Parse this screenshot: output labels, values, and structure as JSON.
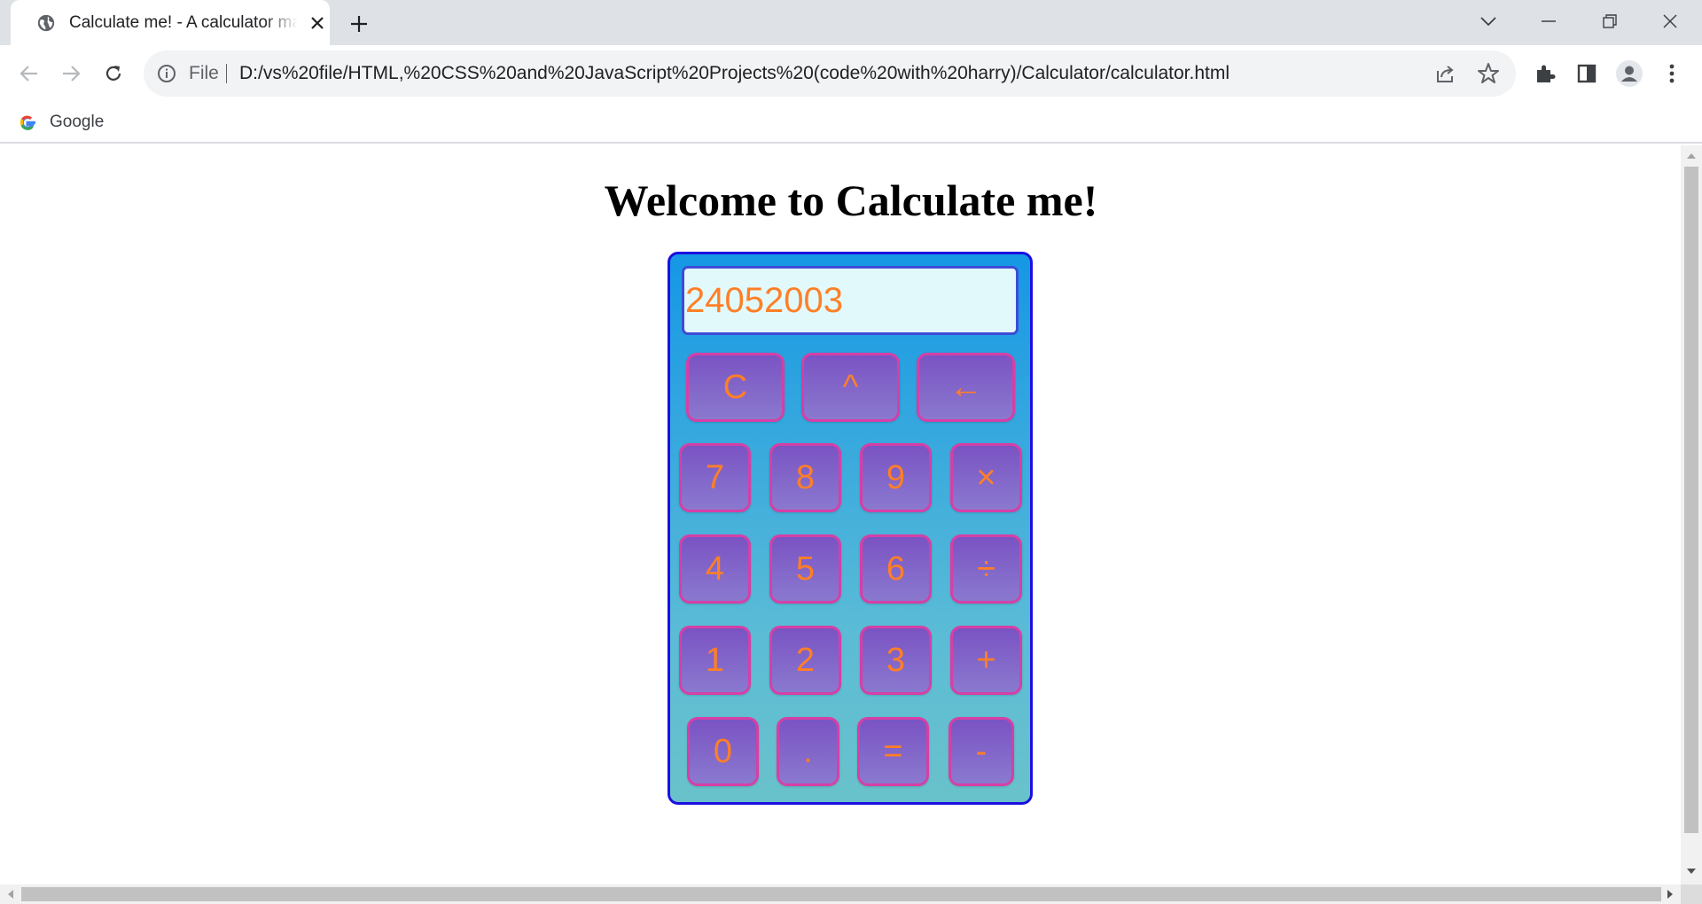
{
  "browser": {
    "tab_title": "Calculate me! - A calculator made by Harry",
    "address_scheme": "File",
    "address_url": "D:/vs%20file/HTML,%20CSS%20and%20JavaScript%20Projects%20(code%20with%20harry)/Calculator/calculator.html",
    "bookmark_label": "Google",
    "icons": [
      "globe-icon",
      "close-icon",
      "plus-icon",
      "chevron-down-icon",
      "minimize-icon",
      "restore-icon",
      "window-close-icon",
      "back-arrow-icon",
      "forward-arrow-icon",
      "reload-icon",
      "info-icon",
      "share-icon",
      "star-icon",
      "extensions-icon",
      "side-panel-icon",
      "profile-icon",
      "kebab-menu-icon",
      "google-g-icon"
    ]
  },
  "page": {
    "heading": "Welcome to Calculate me!"
  },
  "calculator": {
    "display_value": "24052003",
    "top_row": [
      "C",
      "^",
      "←"
    ],
    "rows": [
      [
        "7",
        "8",
        "9",
        "×"
      ],
      [
        "4",
        "5",
        "6",
        "÷"
      ],
      [
        "1",
        "2",
        "3",
        "+"
      ],
      [
        "0",
        ".",
        "=",
        "-"
      ]
    ]
  },
  "colors": {
    "calculator_border": "#1b0fe0",
    "calculator_bg_top": "#1597e5",
    "calculator_bg_bottom": "#69c2cb",
    "display_bg": "#e2f9fb",
    "key_bg": "#7a53c3",
    "key_border": "#d63fa6",
    "key_text": "#ff7f27"
  }
}
